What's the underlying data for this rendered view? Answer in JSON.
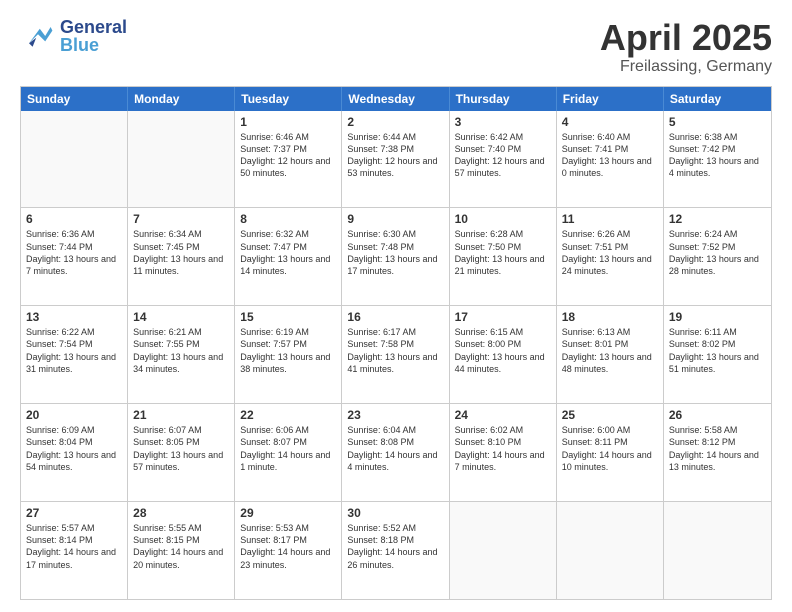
{
  "header": {
    "title": "April 2025",
    "subtitle": "Freilassing, Germany",
    "logo_general": "General",
    "logo_blue": "Blue"
  },
  "weekdays": [
    "Sunday",
    "Monday",
    "Tuesday",
    "Wednesday",
    "Thursday",
    "Friday",
    "Saturday"
  ],
  "weeks": [
    [
      {
        "day": "",
        "sunrise": "",
        "sunset": "",
        "daylight": ""
      },
      {
        "day": "",
        "sunrise": "",
        "sunset": "",
        "daylight": ""
      },
      {
        "day": "1",
        "sunrise": "Sunrise: 6:46 AM",
        "sunset": "Sunset: 7:37 PM",
        "daylight": "Daylight: 12 hours and 50 minutes."
      },
      {
        "day": "2",
        "sunrise": "Sunrise: 6:44 AM",
        "sunset": "Sunset: 7:38 PM",
        "daylight": "Daylight: 12 hours and 53 minutes."
      },
      {
        "day": "3",
        "sunrise": "Sunrise: 6:42 AM",
        "sunset": "Sunset: 7:40 PM",
        "daylight": "Daylight: 12 hours and 57 minutes."
      },
      {
        "day": "4",
        "sunrise": "Sunrise: 6:40 AM",
        "sunset": "Sunset: 7:41 PM",
        "daylight": "Daylight: 13 hours and 0 minutes."
      },
      {
        "day": "5",
        "sunrise": "Sunrise: 6:38 AM",
        "sunset": "Sunset: 7:42 PM",
        "daylight": "Daylight: 13 hours and 4 minutes."
      }
    ],
    [
      {
        "day": "6",
        "sunrise": "Sunrise: 6:36 AM",
        "sunset": "Sunset: 7:44 PM",
        "daylight": "Daylight: 13 hours and 7 minutes."
      },
      {
        "day": "7",
        "sunrise": "Sunrise: 6:34 AM",
        "sunset": "Sunset: 7:45 PM",
        "daylight": "Daylight: 13 hours and 11 minutes."
      },
      {
        "day": "8",
        "sunrise": "Sunrise: 6:32 AM",
        "sunset": "Sunset: 7:47 PM",
        "daylight": "Daylight: 13 hours and 14 minutes."
      },
      {
        "day": "9",
        "sunrise": "Sunrise: 6:30 AM",
        "sunset": "Sunset: 7:48 PM",
        "daylight": "Daylight: 13 hours and 17 minutes."
      },
      {
        "day": "10",
        "sunrise": "Sunrise: 6:28 AM",
        "sunset": "Sunset: 7:50 PM",
        "daylight": "Daylight: 13 hours and 21 minutes."
      },
      {
        "day": "11",
        "sunrise": "Sunrise: 6:26 AM",
        "sunset": "Sunset: 7:51 PM",
        "daylight": "Daylight: 13 hours and 24 minutes."
      },
      {
        "day": "12",
        "sunrise": "Sunrise: 6:24 AM",
        "sunset": "Sunset: 7:52 PM",
        "daylight": "Daylight: 13 hours and 28 minutes."
      }
    ],
    [
      {
        "day": "13",
        "sunrise": "Sunrise: 6:22 AM",
        "sunset": "Sunset: 7:54 PM",
        "daylight": "Daylight: 13 hours and 31 minutes."
      },
      {
        "day": "14",
        "sunrise": "Sunrise: 6:21 AM",
        "sunset": "Sunset: 7:55 PM",
        "daylight": "Daylight: 13 hours and 34 minutes."
      },
      {
        "day": "15",
        "sunrise": "Sunrise: 6:19 AM",
        "sunset": "Sunset: 7:57 PM",
        "daylight": "Daylight: 13 hours and 38 minutes."
      },
      {
        "day": "16",
        "sunrise": "Sunrise: 6:17 AM",
        "sunset": "Sunset: 7:58 PM",
        "daylight": "Daylight: 13 hours and 41 minutes."
      },
      {
        "day": "17",
        "sunrise": "Sunrise: 6:15 AM",
        "sunset": "Sunset: 8:00 PM",
        "daylight": "Daylight: 13 hours and 44 minutes."
      },
      {
        "day": "18",
        "sunrise": "Sunrise: 6:13 AM",
        "sunset": "Sunset: 8:01 PM",
        "daylight": "Daylight: 13 hours and 48 minutes."
      },
      {
        "day": "19",
        "sunrise": "Sunrise: 6:11 AM",
        "sunset": "Sunset: 8:02 PM",
        "daylight": "Daylight: 13 hours and 51 minutes."
      }
    ],
    [
      {
        "day": "20",
        "sunrise": "Sunrise: 6:09 AM",
        "sunset": "Sunset: 8:04 PM",
        "daylight": "Daylight: 13 hours and 54 minutes."
      },
      {
        "day": "21",
        "sunrise": "Sunrise: 6:07 AM",
        "sunset": "Sunset: 8:05 PM",
        "daylight": "Daylight: 13 hours and 57 minutes."
      },
      {
        "day": "22",
        "sunrise": "Sunrise: 6:06 AM",
        "sunset": "Sunset: 8:07 PM",
        "daylight": "Daylight: 14 hours and 1 minute."
      },
      {
        "day": "23",
        "sunrise": "Sunrise: 6:04 AM",
        "sunset": "Sunset: 8:08 PM",
        "daylight": "Daylight: 14 hours and 4 minutes."
      },
      {
        "day": "24",
        "sunrise": "Sunrise: 6:02 AM",
        "sunset": "Sunset: 8:10 PM",
        "daylight": "Daylight: 14 hours and 7 minutes."
      },
      {
        "day": "25",
        "sunrise": "Sunrise: 6:00 AM",
        "sunset": "Sunset: 8:11 PM",
        "daylight": "Daylight: 14 hours and 10 minutes."
      },
      {
        "day": "26",
        "sunrise": "Sunrise: 5:58 AM",
        "sunset": "Sunset: 8:12 PM",
        "daylight": "Daylight: 14 hours and 13 minutes."
      }
    ],
    [
      {
        "day": "27",
        "sunrise": "Sunrise: 5:57 AM",
        "sunset": "Sunset: 8:14 PM",
        "daylight": "Daylight: 14 hours and 17 minutes."
      },
      {
        "day": "28",
        "sunrise": "Sunrise: 5:55 AM",
        "sunset": "Sunset: 8:15 PM",
        "daylight": "Daylight: 14 hours and 20 minutes."
      },
      {
        "day": "29",
        "sunrise": "Sunrise: 5:53 AM",
        "sunset": "Sunset: 8:17 PM",
        "daylight": "Daylight: 14 hours and 23 minutes."
      },
      {
        "day": "30",
        "sunrise": "Sunrise: 5:52 AM",
        "sunset": "Sunset: 8:18 PM",
        "daylight": "Daylight: 14 hours and 26 minutes."
      },
      {
        "day": "",
        "sunrise": "",
        "sunset": "",
        "daylight": ""
      },
      {
        "day": "",
        "sunrise": "",
        "sunset": "",
        "daylight": ""
      },
      {
        "day": "",
        "sunrise": "",
        "sunset": "",
        "daylight": ""
      }
    ]
  ]
}
